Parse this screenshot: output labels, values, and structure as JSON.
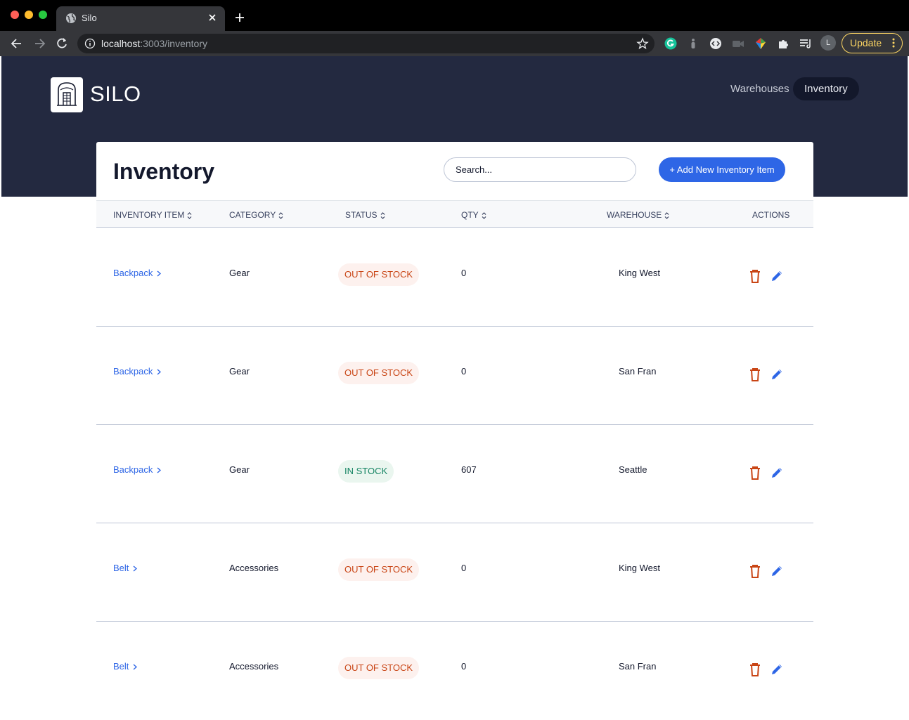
{
  "browser": {
    "tab_title": "Silo",
    "url_host": "localhost",
    "url_path": ":3003/inventory",
    "update_label": "Update",
    "profile_initial": "L"
  },
  "header": {
    "logo_text": "SILO",
    "nav": [
      {
        "label": "Warehouses",
        "active": false
      },
      {
        "label": "Inventory",
        "active": true
      }
    ]
  },
  "page": {
    "title": "Inventory",
    "search_placeholder": "Search...",
    "add_button_label": "+ Add New Inventory Item"
  },
  "table": {
    "columns": [
      "INVENTORY ITEM",
      "CATEGORY",
      "STATUS",
      "QTY",
      "WAREHOUSE",
      "ACTIONS"
    ],
    "rows": [
      {
        "item": "Backpack",
        "category": "Gear",
        "status": "OUT OF STOCK",
        "in_stock": false,
        "qty": "0",
        "warehouse": "King West"
      },
      {
        "item": "Backpack",
        "category": "Gear",
        "status": "OUT OF STOCK",
        "in_stock": false,
        "qty": "0",
        "warehouse": "San Fran"
      },
      {
        "item": "Backpack",
        "category": "Gear",
        "status": "IN STOCK",
        "in_stock": true,
        "qty": "607",
        "warehouse": "Seattle"
      },
      {
        "item": "Belt",
        "category": "Accessories",
        "status": "OUT OF STOCK",
        "in_stock": false,
        "qty": "0",
        "warehouse": "King West"
      },
      {
        "item": "Belt",
        "category": "Accessories",
        "status": "OUT OF STOCK",
        "in_stock": false,
        "qty": "0",
        "warehouse": "San Fran"
      }
    ]
  },
  "colors": {
    "header_bg": "#232940",
    "primary": "#2e66e6",
    "out_of_stock": "#c94515",
    "in_stock": "#158463",
    "delete_icon": "#c94515"
  },
  "icons": {
    "delete": "trash-icon",
    "edit": "pencil-icon",
    "sort": "sort-icon",
    "chevron": "chevron-right-icon"
  }
}
